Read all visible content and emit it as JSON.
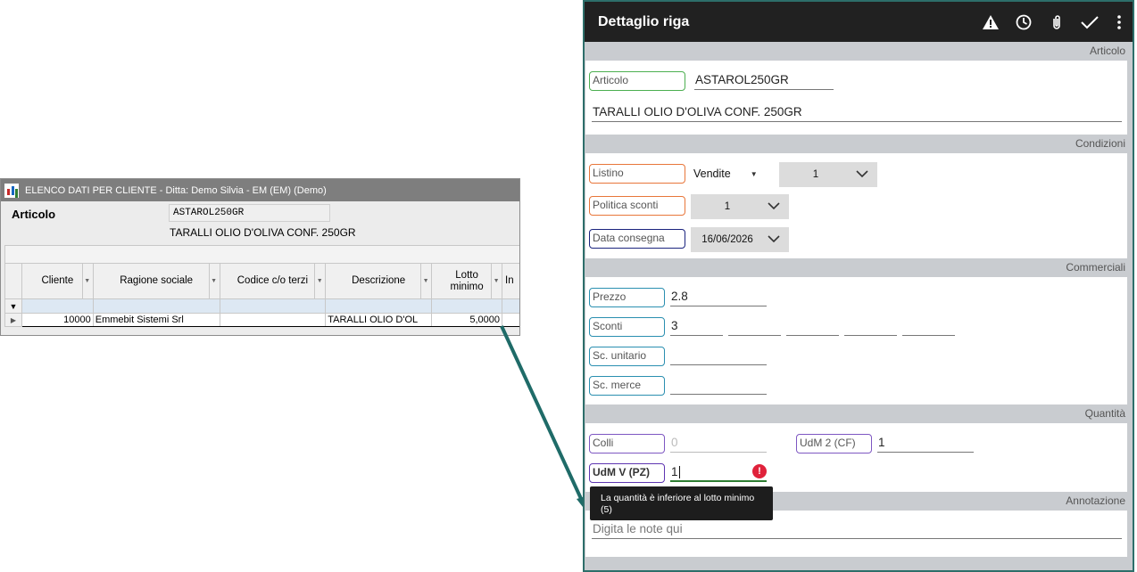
{
  "desktop": {
    "window_title": "ELENCO DATI PER CLIENTE - Ditta: Demo Silvia - EM (EM)  (Demo)",
    "articolo_label": "Articolo",
    "articolo_code": "ASTAROL250GR",
    "articolo_desc": "TARALLI OLIO D'OLIVA CONF. 250GR",
    "columns": [
      "Cliente",
      "Ragione sociale",
      "Codice c/o terzi",
      "Descrizione",
      "Lotto minimo",
      "In"
    ],
    "row": {
      "cliente": "10000",
      "ragione_sociale": "Emmebit Sistemi Srl",
      "codice_terzi": "",
      "descrizione": "TARALLI OLIO D'OL",
      "lotto_minimo": "5,0000"
    }
  },
  "mobile": {
    "title": "Dettaglio riga",
    "icons": [
      "warning-icon",
      "history-icon",
      "attachment-icon",
      "confirm-icon",
      "more-icon"
    ],
    "sections": {
      "articolo": "Articolo",
      "condizioni": "Condizioni",
      "commerciali": "Commerciali",
      "quantita": "Quantità",
      "annotazione": "Annotazione"
    },
    "articolo": {
      "label": "Articolo",
      "code": "ASTAROL250GR",
      "description": "TARALLI OLIO D'OLIVA CONF. 250GR"
    },
    "condizioni": {
      "listino_label": "Listino",
      "listino_type": "Vendite",
      "listino_value": "1",
      "politica_label": "Politica sconti",
      "politica_value": "1",
      "data_label": "Data consegna",
      "data_value": "16/06/2026"
    },
    "commerciali": {
      "prezzo_label": "Prezzo",
      "prezzo_value": "2.8",
      "sconti_label": "Sconti",
      "sconti_values": [
        "3",
        "",
        "",
        "",
        ""
      ],
      "sc_unitario_label": "Sc. unitario",
      "sc_unitario_value": "",
      "sc_merce_label": "Sc. merce",
      "sc_merce_value": ""
    },
    "quantita": {
      "colli_label": "Colli",
      "colli_value": "0",
      "udm2_label": "UdM 2 (CF)",
      "udm2_value": "1",
      "udmv_label": "UdM V (PZ)",
      "udmv_value": "1",
      "error_tooltip": "La quantità è inferiore al lotto minimo (5)"
    },
    "annotazione": {
      "placeholder": "Digita le note qui"
    }
  },
  "colors": {
    "appbar": "#212121",
    "panel_border": "#2d6e6a",
    "arrow": "#1f6b68",
    "error": "#e0223b"
  }
}
